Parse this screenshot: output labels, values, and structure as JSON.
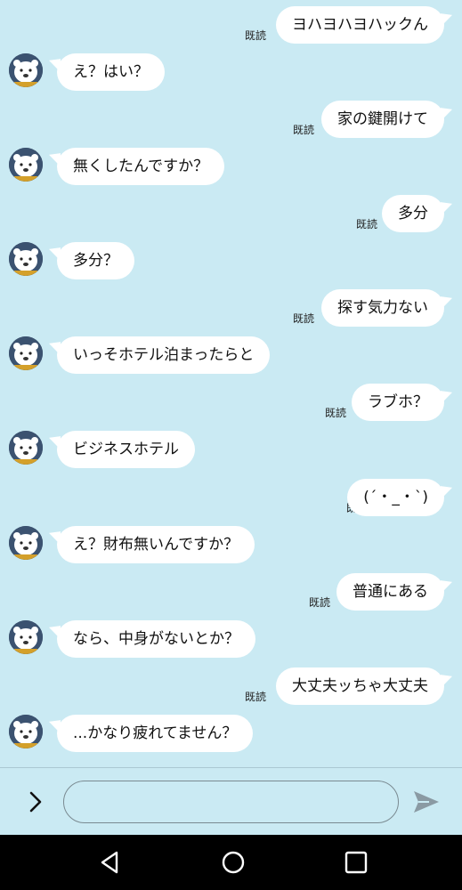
{
  "theme": {
    "background": "#caeaf3",
    "bubble": "#ffffff",
    "navbar": "#000000",
    "send_icon_color": "#8a9aa3"
  },
  "messages": [
    {
      "dir": "out",
      "text": "ヨハヨハヨハックん",
      "read": "既読"
    },
    {
      "dir": "in",
      "text": "え？はい？"
    },
    {
      "dir": "out",
      "text": "家の鍵開けて",
      "read": "既読"
    },
    {
      "dir": "in",
      "text": "無くしたんですか？"
    },
    {
      "dir": "out",
      "text": "多分",
      "read": "既読"
    },
    {
      "dir": "in",
      "text": "多分？"
    },
    {
      "dir": "out",
      "text": "探す気力ない",
      "read": "既読"
    },
    {
      "dir": "in",
      "text": "いっそホテル泊まったらと"
    },
    {
      "dir": "out",
      "text": "ラブホ？",
      "read": "既読"
    },
    {
      "dir": "in",
      "text": "ビジネスホテル"
    },
    {
      "dir": "out",
      "text": "(´・_・`)",
      "read": "既読"
    },
    {
      "dir": "in",
      "text": "え？財布無いんですか？"
    },
    {
      "dir": "out",
      "text": "普通にある",
      "read": "既読"
    },
    {
      "dir": "in",
      "text": "なら、中身がないとか？"
    },
    {
      "dir": "out",
      "text": "大丈夫ッちゃ大丈夫",
      "read": "既読"
    },
    {
      "dir": "in",
      "text": "...かなり疲れてません？"
    }
  ],
  "input": {
    "value": "",
    "placeholder": ""
  },
  "icons": {
    "expand": "chevron-right-icon",
    "send": "send-icon",
    "nav_back": "nav-back-icon",
    "nav_home": "nav-home-icon",
    "nav_recents": "nav-recents-icon",
    "avatar": "white-bear-avatar"
  }
}
